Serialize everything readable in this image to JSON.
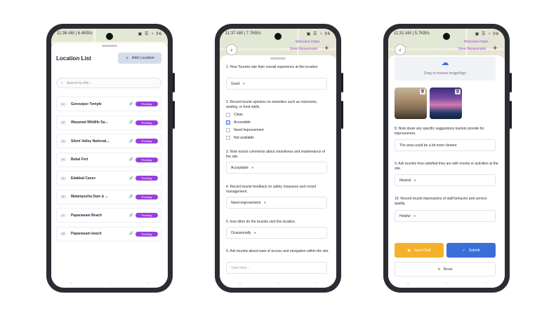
{
  "colors": {
    "accent": "#3a6fd8",
    "badge": "#9b3ee0",
    "draft": "#f6b12a"
  },
  "phone1": {
    "status_time": "11:36 AM | 6.4KB/s",
    "status_icons": "▣ ☰ ◔ 96",
    "title": "Location List",
    "add_label": "Add Location",
    "search_placeholder": "Search by title...",
    "locations": [
      {
        "num": "#1",
        "name": "Guruvayur Temple",
        "status": "Pending"
      },
      {
        "num": "#2",
        "name": "Wayanad Wildlife Sa...",
        "status": "Pending"
      },
      {
        "num": "#3",
        "name": "Silent Valley National...",
        "status": "Pending"
      },
      {
        "num": "#4",
        "name": "Bekal Fort",
        "status": "Pending"
      },
      {
        "num": "#5",
        "name": "Edakkal Caves",
        "status": "Pending"
      },
      {
        "num": "#6",
        "name": "Malampuzha Dam & ...",
        "status": "Pending"
      },
      {
        "num": "#7",
        "name": "Papanasam Beach",
        "status": "Pending"
      },
      {
        "num": "#8",
        "name": "Papanasam beach",
        "status": "Pending"
      }
    ]
  },
  "phone2": {
    "status_time": "11:37 AM | 7.7KB/s",
    "status_icons": "▣ ☰ ◔ 96",
    "map_label_1": "Welcome Hotel",
    "map_label_2": "Sree Narayanatal",
    "q1": "1. How Tourists rate their overall experience at this location",
    "q1_value": "Good",
    "q2": "2. Record tourist opinions on amenities such as restrooms, seating, or food stalls.",
    "q2_options": [
      {
        "label": "Clean",
        "checked": false
      },
      {
        "label": "Accessible",
        "checked": true
      },
      {
        "label": "Need Improvement",
        "checked": false
      },
      {
        "label": "Not available",
        "checked": false
      }
    ],
    "q3": "3. Note tourist comments about cleanliness and maintenance of the site.",
    "q3_value": "Acceptable",
    "q4": "4. Record tourist feedback on safety measures and crowd management.",
    "q4_value": "Need improvement",
    "q5": "5. how often do the tourists visit this location.",
    "q5_value": "Ocassionally",
    "q6": "6. Ask tourists about ease of access and navigation within the site.",
    "q6_placeholder": "Type here..."
  },
  "phone3": {
    "status_time": "11:31 AM | 5.7KB/s",
    "status_icons": "▣ ☰ ◔ 96",
    "map_label_1": "Welcome Hotel",
    "map_label_2": "Sree Narayanatal",
    "upload_label": "Drag or browse image/logo",
    "q8": "8. Note down any specific suggestions tourists provide for improvement.",
    "q8_value": "The area  could be a bit more cleaner",
    "q9": "9. Ask tourists how satisfied they are with events or activities at the site.",
    "q9_value": "Neutral",
    "q10": "10. Record tourist impressions of staff behavior and service quality.",
    "q10_value": "Helpful",
    "draft_label": "Save Draft",
    "submit_label": "Submit",
    "reset_label": "Reset"
  }
}
